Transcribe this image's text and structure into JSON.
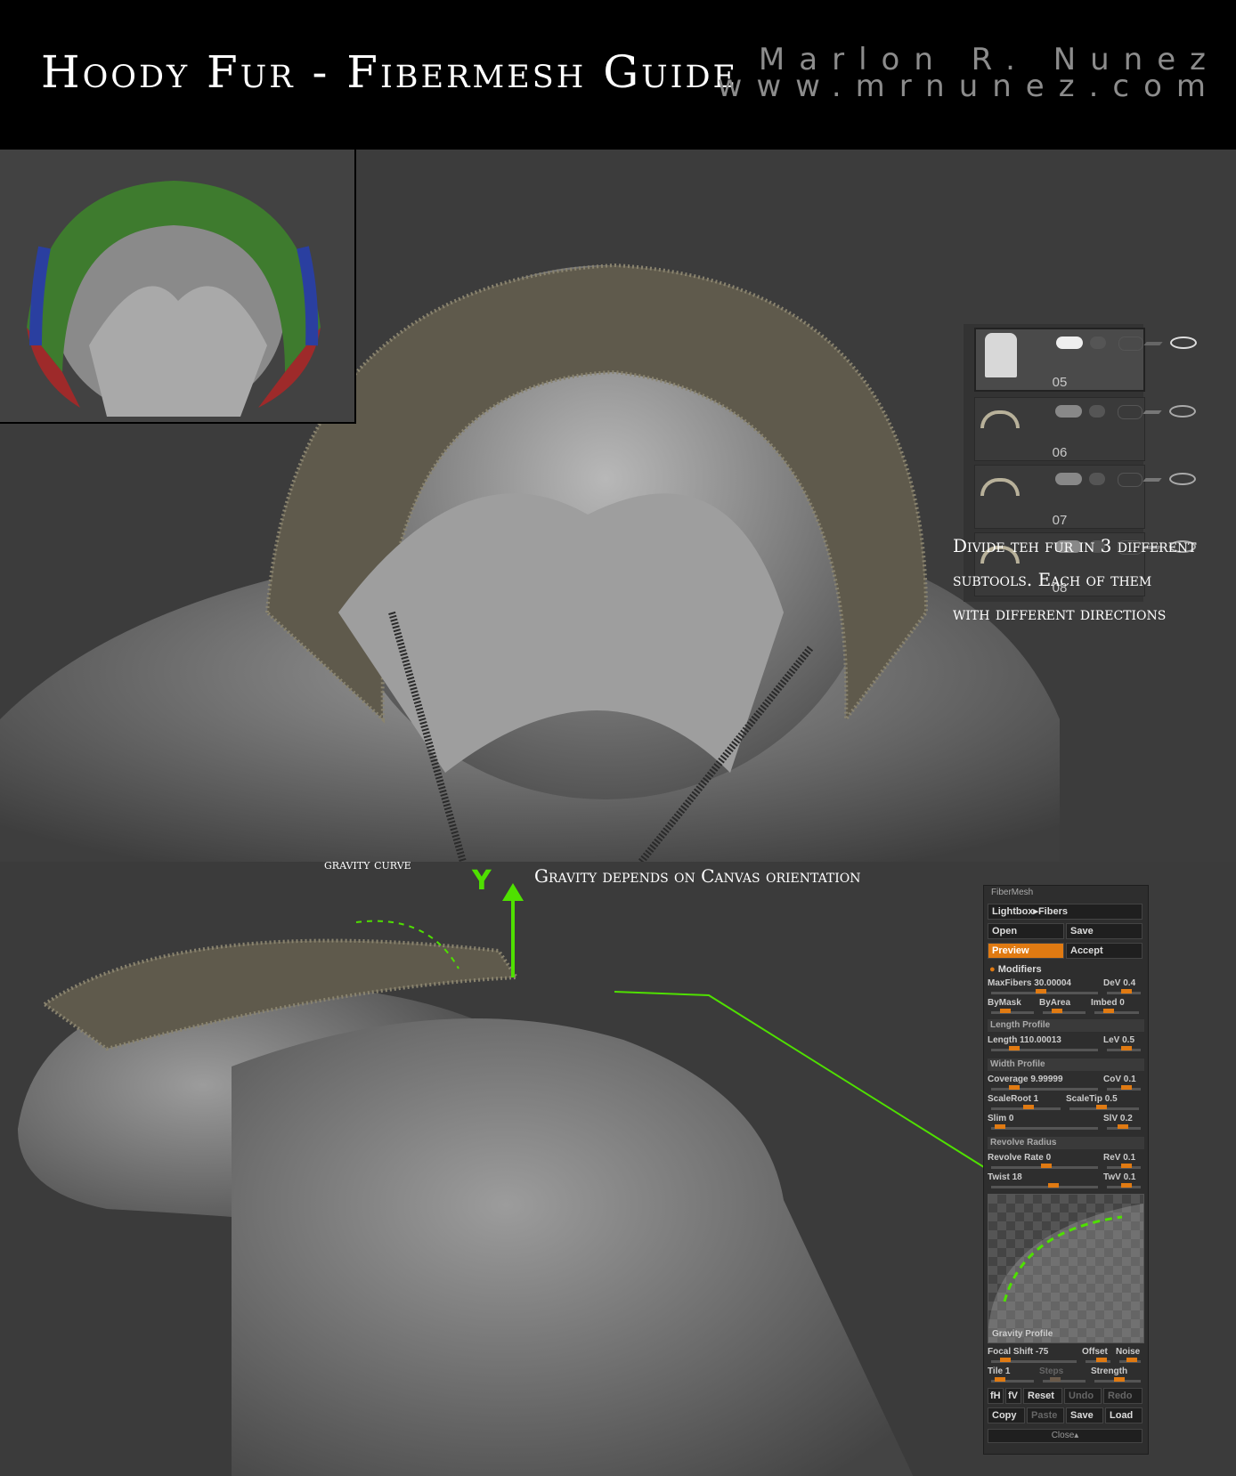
{
  "header": {
    "title": "Hoody Fur - Fibermesh Guide",
    "author_name": "Marlon R. Nunez",
    "author_url": "www.mrnunez.com"
  },
  "notes": {
    "divide_line1": "Divide teh fur in 3 different",
    "divide_line2": "subtools. Each of them",
    "divide_line3": "with different directions",
    "gravity_curve": "gravity curve",
    "axis_y": "Y",
    "gravity_orientation": "Gravity depends on Canvas orientation"
  },
  "subtools": {
    "items": [
      {
        "label": "05",
        "selected": true
      },
      {
        "label": "06",
        "selected": false
      },
      {
        "label": "07",
        "selected": false
      },
      {
        "label": "08",
        "selected": false
      }
    ]
  },
  "fibermesh": {
    "title": "FiberMesh",
    "lightbox": "Lightbox▸Fibers",
    "open": "Open",
    "save": "Save",
    "preview": "Preview",
    "accept": "Accept",
    "modifiers": "Modifiers",
    "maxfibers": "MaxFibers 30.00004",
    "dev": "DeV 0.4",
    "bymask": "ByMask",
    "byarea": "ByArea",
    "imbed": "Imbed 0",
    "length_profile": "Length Profile",
    "length": "Length 110.00013",
    "lev": "LeV 0.5",
    "width_profile": "Width Profile",
    "coverage": "Coverage 9.99999",
    "cov": "CoV 0.1",
    "scaleroot": "ScaleRoot 1",
    "scaletip": "ScaleTip 0.5",
    "slim": "Slim 0",
    "slv": "SlV 0.2",
    "revolve_radius": "Revolve Radius",
    "revolve_rate": "Revolve Rate 0",
    "rev": "ReV 0.1",
    "twist": "Twist 18",
    "twv": "TwV 0.1",
    "gravity_profile": "Gravity Profile",
    "focal_shift": "Focal Shift -75",
    "offset": "Offset",
    "noise": "Noise",
    "tile": "Tile 1",
    "steps": "Steps",
    "strength": "Strength",
    "fh": "fH",
    "fv": "fV",
    "reset": "Reset",
    "undo": "Undo",
    "redo": "Redo",
    "copy": "Copy",
    "paste": "Paste",
    "save2": "Save",
    "load": "Load",
    "close": "Close▴"
  },
  "colors": {
    "accent": "#e07a12",
    "guide_green": "#4fe000"
  }
}
